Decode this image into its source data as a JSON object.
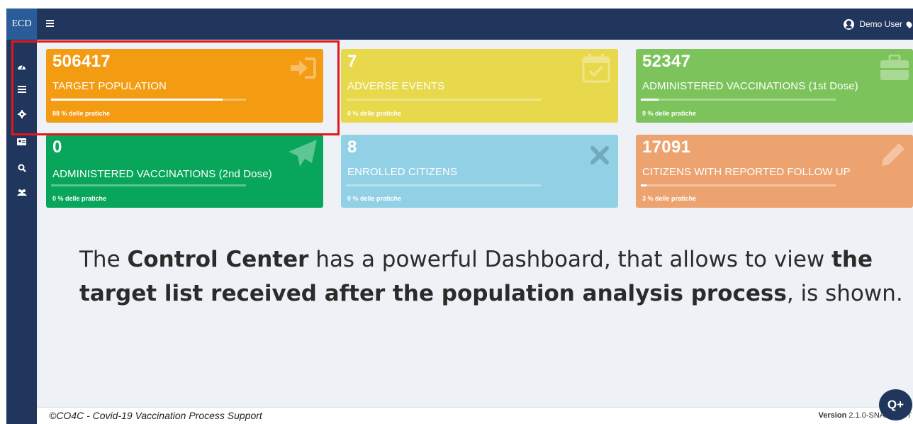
{
  "brand": "ECD",
  "user": {
    "name": "Demo User"
  },
  "sidebar": {
    "items": [
      {
        "icon": "dashboard-icon"
      },
      {
        "icon": "list-icon"
      },
      {
        "icon": "gear-icon"
      },
      {
        "icon": "id-card-icon"
      },
      {
        "icon": "search-icon"
      },
      {
        "icon": "users-icon"
      }
    ]
  },
  "cards": [
    {
      "value": "506417",
      "label": "TARGET POPULATION",
      "percent_text": "88 % delle pratiche",
      "fill_fraction": 0.88,
      "color": "#f39c12",
      "icon": "sign-in-icon"
    },
    {
      "value": "7",
      "label": "ADVERSE EVENTS",
      "percent_text": "0 % delle pratiche",
      "fill_fraction": 0.0,
      "color": "#e8d84b",
      "icon": "calendar-check-icon"
    },
    {
      "value": "52347",
      "label": "ADMINISTERED VACCINATIONS (1st Dose)",
      "percent_text": "9 % delle pratiche",
      "fill_fraction": 0.09,
      "color": "#7dc35c",
      "icon": "briefcase-icon"
    },
    {
      "value": "0",
      "label": "ADMINISTERED VACCINATIONS (2nd Dose)",
      "percent_text": "0 % delle pratiche",
      "fill_fraction": 0.0,
      "color": "#08a65a",
      "icon": "paper-plane-icon"
    },
    {
      "value": "8",
      "label": "ENROLLED CITIZENS",
      "percent_text": "0 % delle pratiche",
      "fill_fraction": 0.0,
      "color": "#92d0e6",
      "icon": "close-icon"
    },
    {
      "value": "17091",
      "label": "CITIZENS WITH REPORTED FOLLOW UP",
      "percent_text": "3 % delle pratiche",
      "fill_fraction": 0.03,
      "color": "#eda370",
      "icon": "pencil-icon"
    }
  ],
  "caption": {
    "p1": "The ",
    "b1": "Control Center",
    "p2": " has a powerful Dashboard, that allows to view ",
    "b2": "the target list received after the population analysis process",
    "p3": ", is shown."
  },
  "footer": {
    "copyright": "©CO4C - Covid-19 Vaccination Process Support",
    "version_label": "Version",
    "version_value": "2.1.0-SNAPSHOT"
  },
  "fab_label": "Q+"
}
